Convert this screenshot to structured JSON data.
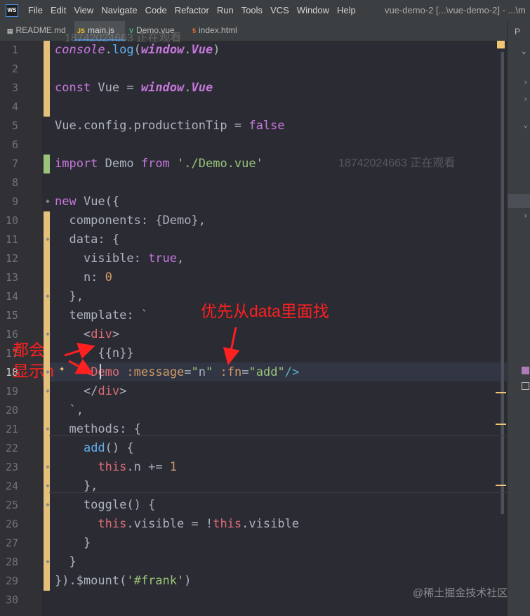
{
  "app": {
    "logo": "WS",
    "window_title": "vue-demo-2 [...\\vue-demo-2] - ...\\m"
  },
  "menu": [
    "File",
    "Edit",
    "View",
    "Navigate",
    "Code",
    "Refactor",
    "Run",
    "Tools",
    "VCS",
    "Window",
    "Help"
  ],
  "tabs": [
    {
      "label": "README.md",
      "icon": "markdown-file-icon"
    },
    {
      "label": "main.js",
      "icon": "javascript-file-icon",
      "active": true
    },
    {
      "label": "Demo.vue",
      "icon": "vue-file-icon"
    },
    {
      "label": "index.html",
      "icon": "html-file-icon"
    }
  ],
  "project_panel": {
    "label": "P"
  },
  "editor": {
    "current_line": 18,
    "line_numbers": [
      "1",
      "2",
      "3",
      "4",
      "5",
      "6",
      "7",
      "8",
      "9",
      "10",
      "11",
      "12",
      "13",
      "14",
      "15",
      "16",
      "17",
      "18",
      "19",
      "20",
      "21",
      "22",
      "23",
      "24",
      "25",
      "26",
      "27",
      "28",
      "29",
      "30"
    ],
    "lines": [
      [
        [
          "console",
          "kw it"
        ],
        [
          ".",
          ""
        ],
        [
          "log",
          "fn"
        ],
        [
          "(",
          ""
        ],
        [
          "window",
          "glob"
        ],
        [
          ".",
          ""
        ],
        [
          "Vue",
          "glob"
        ],
        [
          ")",
          ""
        ]
      ],
      [],
      [
        [
          "const",
          "kw"
        ],
        [
          " Vue = ",
          ""
        ],
        [
          "window",
          "glob"
        ],
        [
          ".",
          ""
        ],
        [
          "Vue",
          "glob"
        ]
      ],
      [],
      [
        [
          "Vue.config.productionTip = ",
          ""
        ],
        [
          "false",
          "kw"
        ]
      ],
      [],
      [
        [
          "import",
          "kw"
        ],
        [
          " Demo ",
          ""
        ],
        [
          "from",
          "kw"
        ],
        [
          " ",
          ""
        ],
        [
          "'./Demo.vue'",
          "str"
        ]
      ],
      [],
      [
        [
          "new",
          "kw"
        ],
        [
          " Vue({",
          ""
        ]
      ],
      [
        [
          "  components: {Demo},",
          ""
        ]
      ],
      [
        [
          "  data: {",
          ""
        ]
      ],
      [
        [
          "    visible: ",
          ""
        ],
        [
          "true",
          "kw"
        ],
        [
          ",",
          ""
        ]
      ],
      [
        [
          "    n: ",
          ""
        ],
        [
          "0",
          "num"
        ]
      ],
      [
        [
          "  },",
          ""
        ]
      ],
      [
        [
          "  template: `",
          ""
        ]
      ],
      [
        [
          "    ",
          ""
        ],
        [
          "<",
          ""
        ],
        [
          "div",
          "tag"
        ],
        [
          ">",
          ""
        ]
      ],
      [
        [
          "      {{n}}",
          ""
        ]
      ],
      [
        [
          "    ",
          ""
        ],
        [
          "<",
          ""
        ],
        [
          "Demo",
          "tag"
        ],
        [
          " ",
          ""
        ],
        [
          ":message",
          "attr"
        ],
        [
          "=",
          ""
        ],
        [
          "\"",
          "str"
        ],
        [
          "n",
          ""
        ],
        [
          "\"",
          "str"
        ],
        [
          " ",
          ""
        ],
        [
          ":fn",
          "attr"
        ],
        [
          "=",
          ""
        ],
        [
          "\"add\"",
          "str"
        ],
        [
          "/>",
          "punct"
        ]
      ],
      [
        [
          "    ",
          ""
        ],
        [
          "</",
          ""
        ],
        [
          "div",
          "tag"
        ],
        [
          ">",
          ""
        ]
      ],
      [
        [
          "  `,",
          ""
        ]
      ],
      [
        [
          "  methods: {",
          ""
        ]
      ],
      [
        [
          "    ",
          ""
        ],
        [
          "add",
          "fn"
        ],
        [
          "() {",
          ""
        ]
      ],
      [
        [
          "      ",
          ""
        ],
        [
          "this",
          "thisk"
        ],
        [
          ".n += ",
          ""
        ],
        [
          "1",
          "num"
        ]
      ],
      [
        [
          "    },",
          ""
        ]
      ],
      [
        [
          "    toggle() {",
          ""
        ]
      ],
      [
        [
          "      ",
          ""
        ],
        [
          "this",
          "thisk"
        ],
        [
          ".visible = !",
          ""
        ],
        [
          "this",
          "thisk"
        ],
        [
          ".visible",
          ""
        ]
      ],
      [
        [
          "    }",
          ""
        ]
      ],
      [
        [
          "  }",
          ""
        ]
      ],
      [
        [
          "}).$mount(",
          ""
        ],
        [
          "'#frank'",
          "str"
        ],
        [
          ")",
          ""
        ]
      ],
      []
    ]
  },
  "annotations": {
    "priority_note": "优先从data里面找",
    "both_show_line1": "都会",
    "both_show_line2": "显示n"
  },
  "watermarks": {
    "viewer_top": "18742024663 正在观看",
    "viewer_mid": "18742024663 正在观看",
    "site": "@稀土掘金技术社区"
  },
  "colors": {
    "background": "#2b2b33",
    "keyword": "#c678dd",
    "string": "#98c379",
    "number": "#d19a66",
    "annotation": "#ff2020"
  }
}
